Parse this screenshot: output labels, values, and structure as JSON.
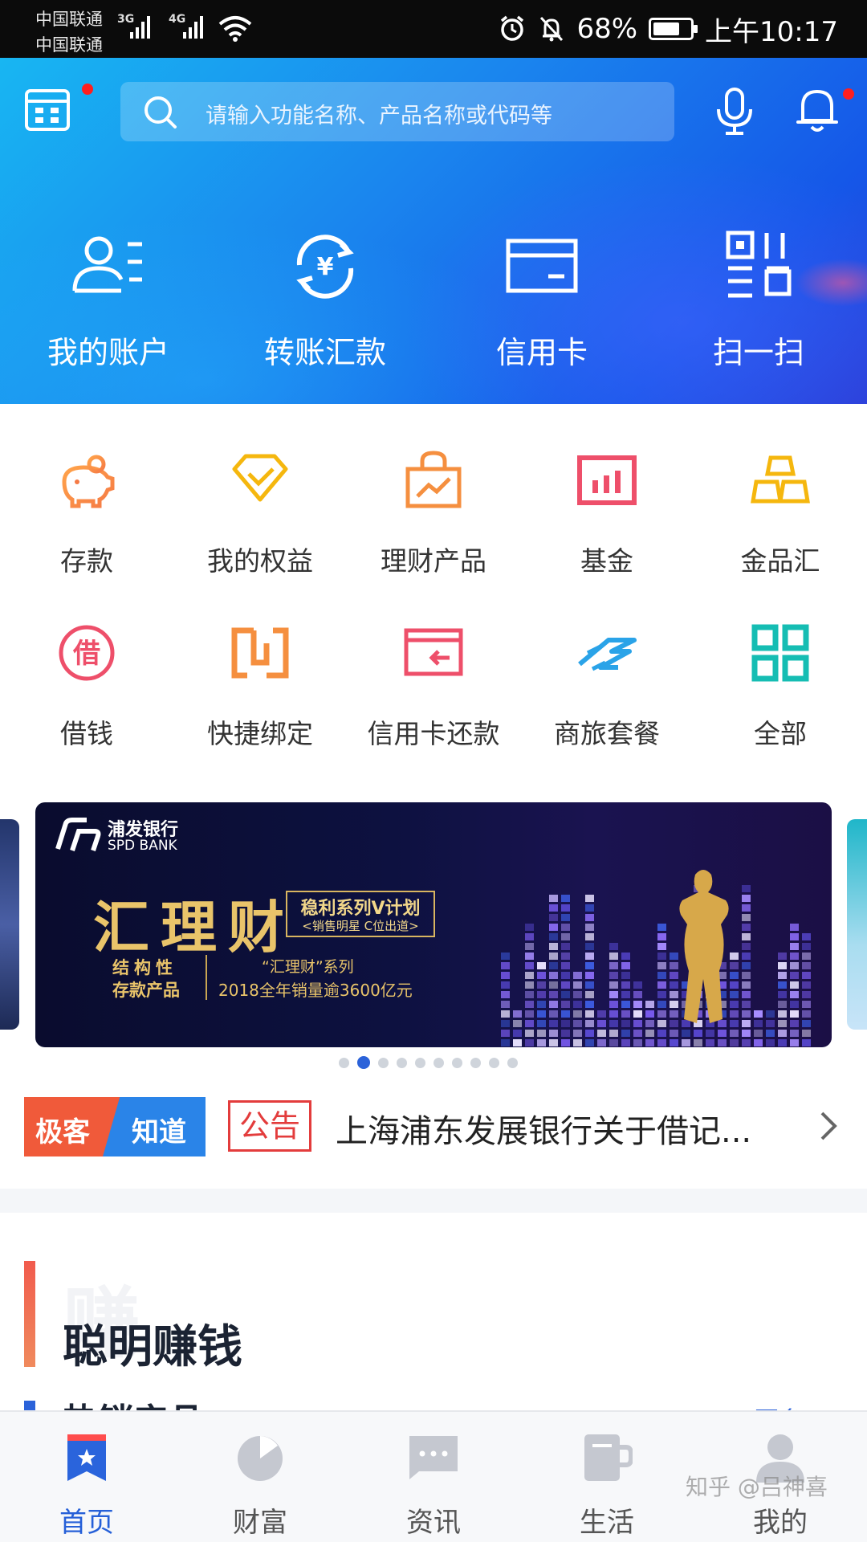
{
  "status_bar": {
    "carrier1": "中国联通",
    "carrier2": "中国联通",
    "net1": "3G",
    "net2": "4G",
    "battery": "68%",
    "time": "上午10:17"
  },
  "header": {
    "search_placeholder": "请输入功能名称、产品名称或代码等",
    "calendar_icon": "calendar-icon",
    "mic_icon": "microphone-icon",
    "bell_icon": "bell-icon"
  },
  "quick_actions": [
    {
      "label": "我的账户",
      "icon": "account-icon"
    },
    {
      "label": "转账汇款",
      "icon": "transfer-icon"
    },
    {
      "label": "信用卡",
      "icon": "credit-card-icon"
    },
    {
      "label": "扫一扫",
      "icon": "scan-icon"
    }
  ],
  "grid": [
    {
      "label": "存款",
      "icon": "piggy-bank-icon"
    },
    {
      "label": "我的权益",
      "icon": "diamond-icon"
    },
    {
      "label": "理财产品",
      "icon": "bag-chart-icon"
    },
    {
      "label": "基金",
      "icon": "fund-chart-icon"
    },
    {
      "label": "金品汇",
      "icon": "gold-bars-icon"
    },
    {
      "label": "借钱",
      "icon": "borrow-icon"
    },
    {
      "label": "快捷绑定",
      "icon": "quick-bind-icon"
    },
    {
      "label": "信用卡还款",
      "icon": "card-repay-icon"
    },
    {
      "label": "商旅套餐",
      "icon": "travel-icon"
    },
    {
      "label": "全部",
      "icon": "all-grid-icon"
    }
  ],
  "banner": {
    "brand_cn": "浦发银行",
    "brand_en": "SPD BANK",
    "main": "汇理财",
    "tag_line1": "稳利系列V计划",
    "tag_line2": "<销售明星 C位出道>",
    "sub1": "结构性",
    "sub2": "存款产品",
    "sub3": "“汇理财”系列",
    "sub4": "2018全年销量逾3600亿元",
    "page_count": 10,
    "active_index": 1
  },
  "notice": {
    "badge_left": "极客",
    "badge_right": "知道",
    "tag": "公告",
    "text": "上海浦东发展银行关于借记..."
  },
  "section": {
    "watermark": "赚",
    "title": "聪明赚钱",
    "sub_title": "热销产品",
    "more": "更多 >"
  },
  "tabbar": [
    {
      "label": "首页",
      "icon": "home-icon",
      "active": true
    },
    {
      "label": "财富",
      "icon": "wealth-icon",
      "active": false
    },
    {
      "label": "资讯",
      "icon": "news-icon",
      "active": false
    },
    {
      "label": "生活",
      "icon": "life-icon",
      "active": false
    },
    {
      "label": "我的",
      "icon": "profile-icon",
      "active": false
    }
  ],
  "watermark": "知乎 @吕神喜",
  "colors": {
    "brand_blue": "#1a86ee",
    "accent_red": "#e33c3c",
    "tab_active": "#2660d8"
  }
}
